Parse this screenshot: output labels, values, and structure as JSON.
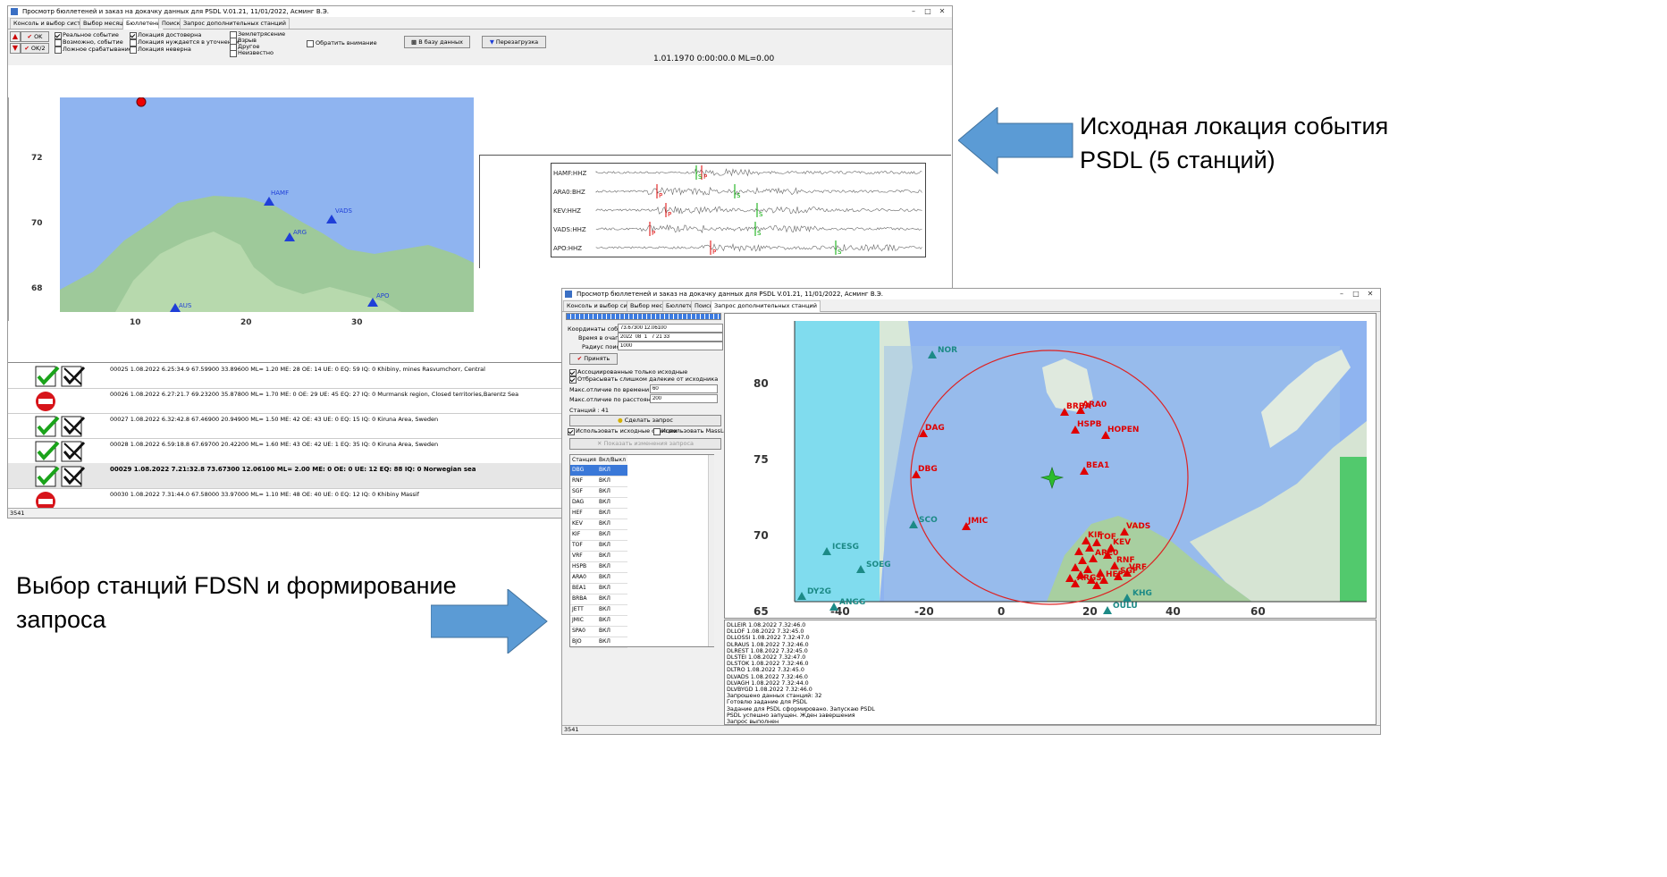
{
  "window1": {
    "title": "Просмотр бюллетеней и заказ на докачку данных для PSDL V.01.21, 11/01/2022,  Асминг В.Э.",
    "tabs": [
      "Консоль и выбор системы",
      "Выбор месяца",
      "Бюллетень",
      "Поиск",
      "Запрос дополнительных станций"
    ],
    "active_tab": 2,
    "ok_label": "OK",
    "ok2_label": "OK/2",
    "check_col1": [
      "Реальное событие",
      "Возможно, событие",
      "Ложное срабатывание"
    ],
    "check_col2": [
      "Локация достоверна",
      "Локация нуждается в уточнении",
      "Локация неверна"
    ],
    "check_col3": [
      "Землетрясение",
      "Взрыв",
      "Другое",
      "Неизвестно"
    ],
    "attention_label": "Обратить внимание",
    "db_button": "В базу данных",
    "reload_button": "Перезагрузка",
    "datetime_display": "1.01.1970  0:00:00.0 ML=0.00",
    "map_y_ticks": [
      "72",
      "70",
      "68"
    ],
    "map_x_ticks": [
      "10",
      "20",
      "30"
    ],
    "stations": [
      "HAMF",
      "VADS",
      "ARG",
      "APO",
      "AUS"
    ],
    "traces": [
      "HAMF:HHZ",
      "ARA0:BHZ",
      "KEV:HHZ",
      "VADS:HHZ",
      "APO:HHZ"
    ],
    "phase_p": "P",
    "phase_s": "S",
    "events": [
      {
        "text": "00025   1.08.2022   6.25:34.9 67.59900 33.89600 ML= 1.20  ME: 28  OE: 14  UE:  0  EQ: 59  IQ:  0   Khibiny, mines Rasvumchorr, Central",
        "status": "ok",
        "bold": false
      },
      {
        "text": "00026   1.08.2022   6.27:21.7 69.23200 35.87800 ML= 1.70  ME:  0  OE: 29  UE: 45  EQ: 27  IQ:  0   Murmansk region, Closed territories,Barentz Sea",
        "status": "deny",
        "bold": false
      },
      {
        "text": "00027   1.08.2022   6.32:42.8 67.46900 20.94900 ML= 1.50  ME: 42  OE: 43  UE:  0  EQ: 15  IQ:  0   Kiruna Area, Sweden",
        "status": "ok",
        "bold": false
      },
      {
        "text": "00028   1.08.2022   6.59:18.8 67.69700 20.42200 ML= 1.60  ME: 43  OE: 42  UE:  1  EQ: 35  IQ:  0   Kiruna Area, Sweden",
        "status": "ok",
        "bold": false
      },
      {
        "text": "00029   1.08.2022   7.21:32.8 73.67300 12.06100 ML= 2.00  ME:  0  OE:  0  UE: 12  EQ: 88  IQ:  0   Norwegian sea",
        "status": "ok",
        "bold": true
      },
      {
        "text": "00030   1.08.2022   7.31:44.0 67.58000 33.97000 ML= 1.10  ME: 48  OE: 40  UE:  0  EQ: 12  IQ:  0   Khibiny Massif",
        "status": "deny",
        "bold": false
      }
    ],
    "status_left": "3541"
  },
  "window2": {
    "title": "Просмотр бюллетеней и заказ на докачку данных для PSDL V.01.21, 11/01/2022,  Асминг В.Э.",
    "tabs": [
      "Консоль и выбор системы",
      "Выбор месяца",
      "Бюллетень",
      "Поиск",
      "Запрос дополнительных станций"
    ],
    "active_tab": 4,
    "coords_label": "Координаты события",
    "coords_value": "73.67300 12.06100",
    "time_label": "Время в очаге",
    "time_value": "2022  08  1   7 21 33",
    "radius_label": "Радиус поиска",
    "radius_value": "1000",
    "accept_button": "Принять",
    "assoc_only": "Ассоциированные только исходные",
    "discard_far": "Отбрасывать слишком далекие от исходника",
    "max_time_label": "Макс.отличие по времени (сек):",
    "max_time_value": "60",
    "max_dist_label": "Макс.отличие по расстоянию (км):",
    "max_dist_value": "200",
    "stations_count": "Станций : 41",
    "make_request_button": "Сделать запрос",
    "use_source_stations": "Использовать исходные станции",
    "use_massloader": "Использовать MassLoader",
    "show_changes_button": "Показать изменения запроса",
    "table_headers": [
      "Станция",
      "Вкл/Выкл"
    ],
    "table_rows": [
      [
        "DBG",
        "ВКЛ"
      ],
      [
        "RNF",
        "ВКЛ"
      ],
      [
        "SGF",
        "ВКЛ"
      ],
      [
        "DAG",
        "ВКЛ"
      ],
      [
        "HEF",
        "ВКЛ"
      ],
      [
        "KEV",
        "ВКЛ"
      ],
      [
        "KIF",
        "ВКЛ"
      ],
      [
        "TOF",
        "ВКЛ"
      ],
      [
        "VRF",
        "ВКЛ"
      ],
      [
        "HSPB",
        "ВКЛ"
      ],
      [
        "ARA0",
        "ВКЛ"
      ],
      [
        "BEA1",
        "ВКЛ"
      ],
      [
        "BRBA",
        "ВКЛ"
      ],
      [
        "JETT",
        "ВКЛ"
      ],
      [
        "JMIC",
        "ВКЛ"
      ],
      [
        "SPA0",
        "ВКЛ"
      ],
      [
        "BJO",
        "ВКЛ"
      ]
    ],
    "map_y_ticks": [
      "80",
      "75",
      "70",
      "65"
    ],
    "map_x_ticks": [
      "-40",
      "-20",
      "0",
      "20",
      "40",
      "60"
    ],
    "red_stations": [
      "BRBA",
      "ARA0",
      "HSPB",
      "HOPEN",
      "DAG",
      "DBG",
      "BEA1",
      "JMIC",
      "VADS",
      "TOF",
      "KEV",
      "HEF",
      "SGF",
      "RNF",
      "VRF",
      "KIF",
      "ARGS",
      "ARE0"
    ],
    "teal_stations": [
      "NOR",
      "SCO",
      "ICESG",
      "SOEG",
      "DY2G",
      "ANGG",
      "OULU",
      "KHG"
    ],
    "log_lines": [
      "DLLEIR  1.08.2022   7.32:46.0",
      "DLLOF  1.08.2022   7.32:45.0",
      "DLLOSSI  1.08.2022   7.32:47.0",
      "DLRAUS  1.08.2022   7.32:46.0",
      "DLREST  1.08.2022   7.32:45.0",
      "DLSTEI  1.08.2022   7.32:47.0",
      "DLSTOK  1.08.2022   7.32:46.0",
      "DLTRO  1.08.2022   7.32:45.0",
      "DLVADS  1.08.2022   7.32:46.0",
      "DLVAGH  1.08.2022   7.32:44.0",
      "DLVBYGD  1.08.2022   7.32:46.0",
      "Запрошено данных станций: 32",
      "Готовлю задание для PSDL",
      "Задание для PSDL сформировано. Запускаю PSDL",
      "PSDL успешно запущен. Жден завершения",
      "Запрос выполнен"
    ],
    "status_left": "3541"
  },
  "annotations": {
    "right_line1": "Исходная локация события",
    "right_line2": "PSDL (5 станций)",
    "left_line1": "Выбор станций FDSN и формирование",
    "left_line2": "запроса"
  },
  "colors": {
    "arrow": "#5b9bd5",
    "ocean": "#8fb4f0",
    "station_red": "#e00000",
    "station_teal": "#1c8a86",
    "station_blue": "#1f3fd8",
    "epicenter": "#2dbb2d"
  }
}
